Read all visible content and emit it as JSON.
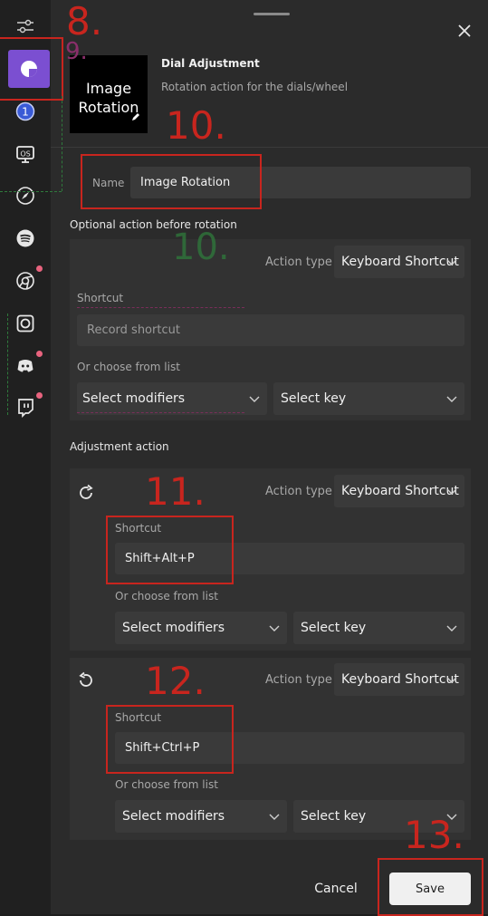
{
  "header": {
    "title": "Dial Adjustment",
    "subtitle": "Rotation action for the dials/wheel",
    "thumbnail_text": "Image Rotation"
  },
  "name_field": {
    "label": "Name",
    "value": "Image Rotation"
  },
  "optional_section": {
    "heading": "Optional action before rotation",
    "action_type_label": "Action type",
    "action_type_value": "Keyboard Shortcut",
    "shortcut_label": "Shortcut",
    "shortcut_placeholder": "Record shortcut",
    "list_label": "Or choose from list",
    "modifiers": "Select modifiers",
    "key": "Select key"
  },
  "adjustment_section": {
    "heading": "Adjustment action",
    "clockwise": {
      "action_type_label": "Action type",
      "action_type_value": "Keyboard Shortcut",
      "shortcut_label": "Shortcut",
      "shortcut_value": "Shift+Alt+P",
      "list_label": "Or choose from list",
      "modifiers": "Select modifiers",
      "key": "Select key"
    },
    "counterclockwise": {
      "action_type_label": "Action type",
      "action_type_value": "Keyboard Shortcut",
      "shortcut_label": "Shortcut",
      "shortcut_value": "Shift+Ctrl+P",
      "list_label": "Or choose from list",
      "modifiers": "Select modifiers",
      "key": "Select key"
    }
  },
  "footer": {
    "cancel": "Cancel",
    "save": "Save"
  },
  "annotations": {
    "n8": "8.",
    "n9": "9.",
    "n10": "10.",
    "n10b": "10.",
    "n11": "11.",
    "n12": "12.",
    "n13": "13."
  },
  "sidebar_icons": [
    "sliders-icon",
    "dial-app-icon",
    "1password-icon",
    "obs-icon",
    "compass-icon",
    "spotify-icon",
    "chrome-icon",
    "record-icon",
    "discord-icon",
    "twitch-icon"
  ],
  "colors": {
    "accent": "#7b4fd1",
    "annotation": "#c8251e",
    "badge": "#e8637e"
  }
}
